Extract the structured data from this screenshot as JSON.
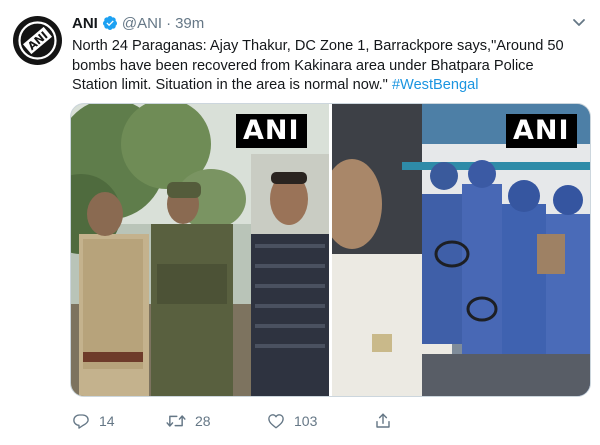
{
  "tweet": {
    "display_name": "ANI",
    "handle": "@ANI",
    "separator": "·",
    "time": "39m",
    "text": "North 24 Paraganas: Ajay Thakur, DC Zone 1, Barrackpore says,\"Around 50 bombs have been recovered from Kakinara area under Bhatpara Police Station limit. Situation in the area is normal now.\"",
    "hashtag": "#WestBengal",
    "avatar_logo": "ANI",
    "media": [
      {
        "watermark": "ANI"
      },
      {
        "watermark": "ANI"
      }
    ],
    "stats": {
      "replies": "14",
      "retweets": "28",
      "likes": "103"
    }
  },
  "icons": {
    "verified": "verified-badge-icon",
    "caret": "chevron-down-icon",
    "reply": "reply-icon",
    "retweet": "retweet-icon",
    "like": "heart-icon",
    "share": "share-icon"
  },
  "colors": {
    "link": "#1b95e0",
    "muted": "#657786",
    "verified": "#1da1f2"
  }
}
